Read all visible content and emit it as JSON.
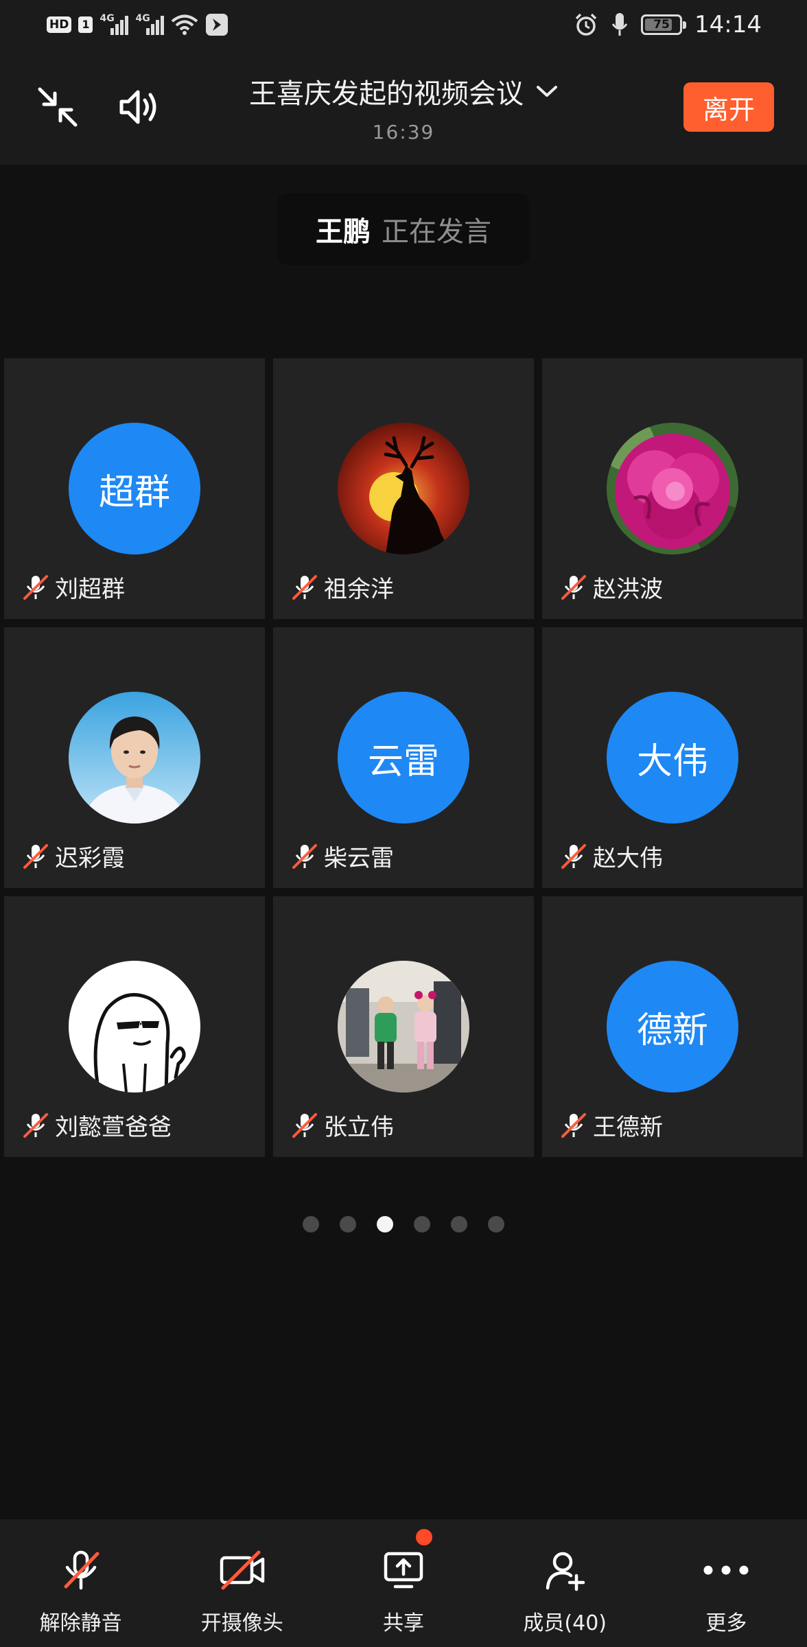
{
  "status_bar": {
    "hd": "HD",
    "sim": "1",
    "net1": "4G",
    "net2": "4G",
    "battery": "75",
    "time": "14:14"
  },
  "header": {
    "title": "王喜庆发起的视频会议",
    "duration": "16:39",
    "leave_label": "离开"
  },
  "speaking": {
    "name": "王鹏",
    "status": "正在发言"
  },
  "participants": [
    {
      "name": "刘超群",
      "avatar_text": "超群",
      "avatar": "text",
      "muted": true
    },
    {
      "name": "祖余洋",
      "avatar_text": "",
      "avatar": "deer-sunset-photo",
      "muted": true
    },
    {
      "name": "赵洪波",
      "avatar_text": "",
      "avatar": "peony-flower-photo",
      "muted": true
    },
    {
      "name": "迟彩霞",
      "avatar_text": "",
      "avatar": "portrait-photo",
      "muted": true
    },
    {
      "name": "柴云雷",
      "avatar_text": "云雷",
      "avatar": "text",
      "muted": true
    },
    {
      "name": "赵大伟",
      "avatar_text": "大伟",
      "avatar": "text",
      "muted": true
    },
    {
      "name": "刘懿萱爸爸",
      "avatar_text": "",
      "avatar": "cartoon-sunglasses",
      "muted": true
    },
    {
      "name": "张立伟",
      "avatar_text": "",
      "avatar": "children-photo",
      "muted": true
    },
    {
      "name": "王德新",
      "avatar_text": "德新",
      "avatar": "text",
      "muted": true
    }
  ],
  "pager": {
    "count": 6,
    "active_index": 2
  },
  "toolbar": {
    "unmute": "解除静音",
    "camera": "开摄像头",
    "share": "共享",
    "members": "成员(40)",
    "more": "更多"
  },
  "colors": {
    "accent_blue": "#1e88f5",
    "leave_orange": "#ff5f2e",
    "mute_red": "#ff5a3c",
    "background": "#111111"
  }
}
